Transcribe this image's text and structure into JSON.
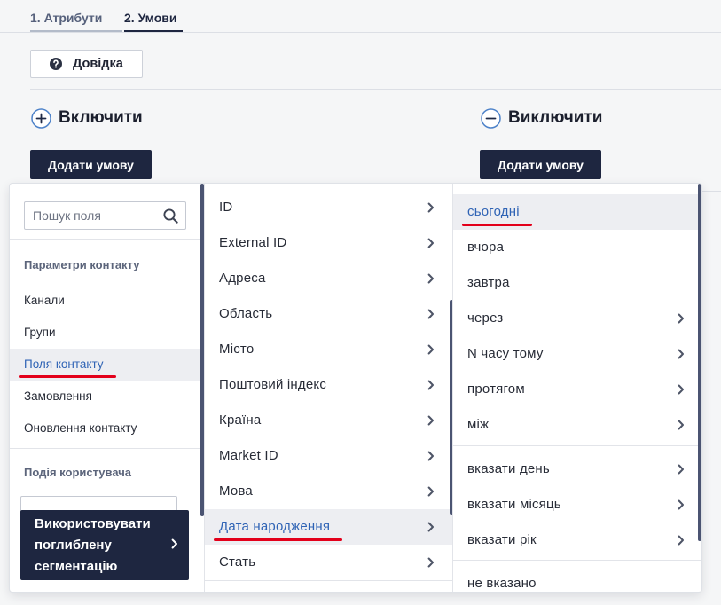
{
  "theme": {
    "navy": "#1e2640",
    "accent": "#2f63b5",
    "annotation": "#e3001b",
    "highlight": "#edeef2",
    "scrollbar": "#4b5472"
  },
  "tabs": [
    {
      "label": "1. Атрибути",
      "active": false
    },
    {
      "label": "2. Умови",
      "active": true
    }
  ],
  "help_button": {
    "label": "Довідка",
    "icon": "question-circle-icon"
  },
  "include_section": {
    "title": "Включити",
    "icon": "plus-circle-icon",
    "add_button_label": "Додати умову"
  },
  "exclude_section": {
    "title": "Виключити",
    "icon": "minus-circle-icon",
    "add_button_label": "Додати умову"
  },
  "field_picker": {
    "search": {
      "placeholder": "Пошук поля",
      "value": "",
      "icon": "search-icon"
    },
    "contact_group": {
      "title": "Параметри контакту",
      "items": [
        {
          "label": "Канали",
          "highlighted": false
        },
        {
          "label": "Групи",
          "highlighted": false
        },
        {
          "label": "Поля контакту",
          "highlighted": true
        },
        {
          "label": "Замовлення",
          "highlighted": false
        },
        {
          "label": "Оновлення контакту",
          "highlighted": false
        }
      ]
    },
    "event_group": {
      "title": "Подія користувача"
    },
    "advanced_button": {
      "label": "Використовувати поглиблену сегментацію",
      "icon": "chevron-right-icon"
    },
    "fields": [
      {
        "label": "ID",
        "has_submenu": true,
        "highlighted": false
      },
      {
        "label": "External ID",
        "has_submenu": true,
        "highlighted": false
      },
      {
        "label": "Адреса",
        "has_submenu": true,
        "highlighted": false
      },
      {
        "label": "Область",
        "has_submenu": true,
        "highlighted": false
      },
      {
        "label": "Місто",
        "has_submenu": true,
        "highlighted": false
      },
      {
        "label": "Поштовий індекс",
        "has_submenu": true,
        "highlighted": false
      },
      {
        "label": "Країна",
        "has_submenu": true,
        "highlighted": false
      },
      {
        "label": "Market ID",
        "has_submenu": true,
        "highlighted": false
      },
      {
        "label": "Мова",
        "has_submenu": true,
        "highlighted": false
      },
      {
        "label": "Дата народження",
        "has_submenu": true,
        "highlighted": true
      },
      {
        "label": "Стать",
        "has_submenu": true,
        "highlighted": false
      }
    ],
    "condition_groups": [
      [
        {
          "label": "сьогодні",
          "has_submenu": false,
          "highlighted": true
        },
        {
          "label": "вчора",
          "has_submenu": false,
          "highlighted": false
        },
        {
          "label": "завтра",
          "has_submenu": false,
          "highlighted": false
        },
        {
          "label": "через",
          "has_submenu": true,
          "highlighted": false
        },
        {
          "label": "N часу тому",
          "has_submenu": true,
          "highlighted": false
        },
        {
          "label": "протягом",
          "has_submenu": true,
          "highlighted": false
        },
        {
          "label": "між",
          "has_submenu": true,
          "highlighted": false
        }
      ],
      [
        {
          "label": "вказати день",
          "has_submenu": true,
          "highlighted": false
        },
        {
          "label": "вказати місяць",
          "has_submenu": true,
          "highlighted": false
        },
        {
          "label": "вказати рік",
          "has_submenu": true,
          "highlighted": false
        }
      ],
      [
        {
          "label": "не вказано",
          "has_submenu": false,
          "highlighted": false
        }
      ]
    ]
  }
}
